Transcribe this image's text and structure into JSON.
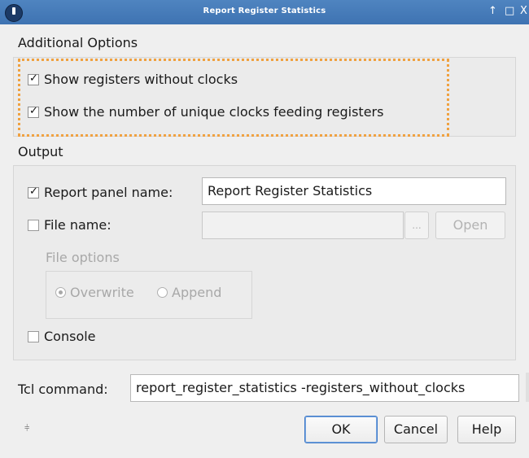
{
  "window": {
    "title": "Report Register Statistics",
    "controls": {
      "pin": "↑",
      "maximize": "□",
      "close": "X"
    }
  },
  "additional_options": {
    "title": "Additional Options",
    "options": [
      {
        "label": "Show registers without clocks",
        "checked": true
      },
      {
        "label": "Show the number of unique clocks feeding registers",
        "checked": true
      }
    ]
  },
  "output": {
    "title": "Output",
    "report_panel": {
      "label": "Report panel name:",
      "checked": true,
      "value": "Report Register Statistics"
    },
    "file_name": {
      "label": "File name:",
      "checked": false,
      "value": "",
      "browse_label": "...",
      "open_label": "Open"
    },
    "file_options": {
      "title": "File options",
      "overwrite_label": "Overwrite",
      "append_label": "Append",
      "selected": "Overwrite"
    },
    "console": {
      "label": "Console",
      "checked": false
    }
  },
  "tcl": {
    "label": "Tcl command:",
    "value": "report_register_statistics -registers_without_clocks"
  },
  "buttons": {
    "ok": "OK",
    "cancel": "Cancel",
    "help": "Help"
  },
  "grip_icon": "resize-grip-icon"
}
